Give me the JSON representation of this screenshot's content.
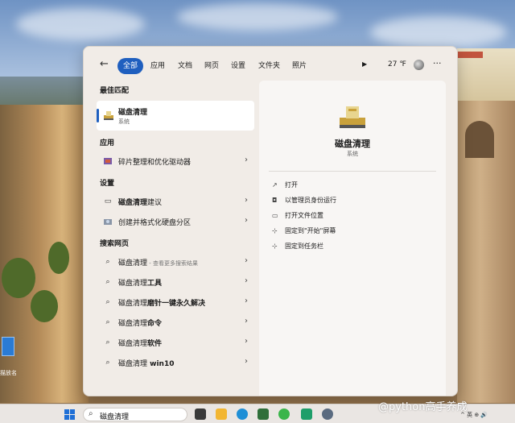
{
  "search_panel": {
    "back_label": "←",
    "tabs": [
      "全部",
      "应用",
      "文档",
      "网页",
      "设置",
      "文件夹",
      "照片"
    ],
    "play_label": "▶",
    "temperature": "27 ℉",
    "more_label": "···"
  },
  "best_match": {
    "section": "最佳匹配",
    "title": "磁盘清理",
    "subtitle": "系统"
  },
  "apps": {
    "section": "应用",
    "items": [
      {
        "label": "碎片整理和优化驱动器"
      }
    ]
  },
  "settings": {
    "section": "设置",
    "items": [
      {
        "bold": "磁盘清理",
        "rest": "建议"
      },
      {
        "bold": "",
        "rest": "创建并格式化硬盘分区"
      }
    ]
  },
  "web": {
    "section": "搜索网页",
    "items": [
      {
        "bold": "磁盘清理",
        "rest": "",
        "hint": " - 查看更多搜索结果"
      },
      {
        "bold": "磁盘清理",
        "rest": "工具",
        "hint": ""
      },
      {
        "bold": "磁盘清理",
        "rest": "磨针一键永久解决",
        "hint": ""
      },
      {
        "bold": "磁盘清理",
        "rest": "命令",
        "hint": ""
      },
      {
        "bold": "磁盘清理",
        "rest": "软件",
        "hint": ""
      },
      {
        "bold": "磁盘清理",
        "rest": " win10",
        "hint": ""
      }
    ]
  },
  "detail": {
    "title": "磁盘清理",
    "subtitle": "系统",
    "actions": [
      {
        "icon": "open-icon",
        "label": "打开"
      },
      {
        "icon": "admin-shield-icon",
        "label": "以管理员身份运行"
      },
      {
        "icon": "folder-icon",
        "label": "打开文件位置"
      },
      {
        "icon": "pin-icon",
        "label": "固定到\"开始\"屏幕"
      },
      {
        "icon": "pin-icon",
        "label": "固定到任务栏"
      }
    ]
  },
  "taskbar": {
    "search_value": "磁盘清理",
    "tray_text": "^ 英 ⊕ 🔊"
  },
  "watermark": "@python高手养成",
  "desktop_icon_label": "描放名"
}
